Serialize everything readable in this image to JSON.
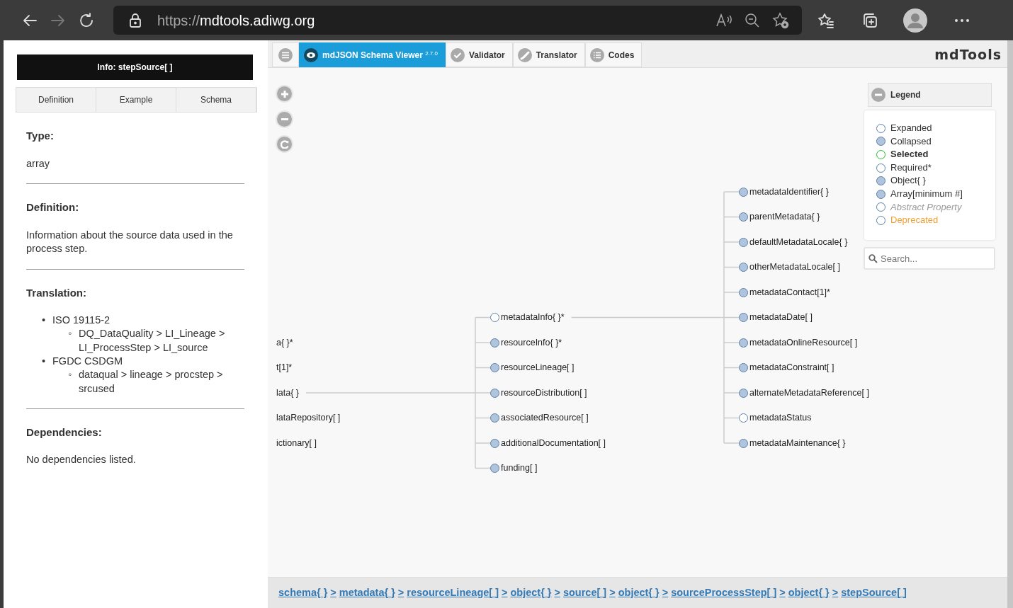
{
  "browser": {
    "url_scheme": "https://",
    "url_host": "mdtools.adiwg.org"
  },
  "info_panel": {
    "title": "Info: stepSource[ ]",
    "tabs": [
      {
        "label": "Definition",
        "selected": false
      },
      {
        "label": "Example",
        "selected": false
      },
      {
        "label": "Schema",
        "selected": false
      }
    ],
    "sections": [
      {
        "kind": "text",
        "heading": "Type:",
        "text": "array"
      },
      {
        "kind": "text",
        "heading": "Definition:",
        "text": "Information about the source data used in the process step."
      },
      {
        "kind": "list",
        "heading": "Translation:",
        "items": [
          {
            "marker": "•",
            "label": "ISO 19115-2",
            "children": [
              {
                "marker": "◦",
                "label": "DQ_DataQuality > LI_Lineage > LI_ProcessStep > LI_source"
              }
            ]
          },
          {
            "marker": "•",
            "label": "FGDC CSDGM",
            "children": [
              {
                "marker": "◦",
                "label": "dataqual > lineage > procstep > srcused"
              }
            ]
          }
        ]
      },
      {
        "kind": "text",
        "heading": "Dependencies:",
        "text": "No dependencies listed."
      }
    ]
  },
  "toolbar": {
    "tabs": [
      {
        "label": "mdJSON Schema Viewer $^{2.7.0}$",
        "kind": "viewer",
        "selected": true
      },
      {
        "label": "Validator",
        "kind": "validator",
        "selected": false
      },
      {
        "label": "Translator",
        "kind": "translator",
        "selected": false
      },
      {
        "label": "Codes",
        "kind": "codes",
        "selected": false
      }
    ],
    "logo": "mdTools"
  },
  "legend": {
    "title": "Legend",
    "expanded": true,
    "items": [
      {
        "kind": "expanded",
        "label": "Expanded"
      },
      {
        "kind": "collapsed",
        "label": "Collapsed"
      },
      {
        "kind": "selected",
        "label": "Selected"
      },
      {
        "kind": "required",
        "label": "Required*"
      },
      {
        "kind": "object",
        "label": "Object{ }"
      },
      {
        "kind": "array",
        "label": "Array[minimum #]"
      },
      {
        "kind": "abstract",
        "label": "Abstract Property"
      },
      {
        "kind": "deprecated",
        "label": "Deprecated"
      }
    ]
  },
  "search": {
    "placeholder": "Search..."
  },
  "tree": [
    {
      "label": "a{ }*"
    },
    {
      "label": "t[1]*"
    },
    {
      "label": "lata{ }",
      "children": [
        {
          "label": "metadataInfo{ }*",
          "collapsed": false,
          "children": [
            {
              "label": "metadataIdentifier{ }",
              "collapsed": true
            },
            {
              "label": "parentMetadata{ }",
              "collapsed": true
            },
            {
              "label": "defaultMetadataLocale{ }",
              "collapsed": true
            },
            {
              "label": "otherMetadataLocale[ ]",
              "collapsed": true
            },
            {
              "label": "metadataContact[1]*",
              "collapsed": true
            },
            {
              "label": "metadataDate[ ]",
              "collapsed": true
            },
            {
              "label": "metadataOnlineResource[ ]",
              "collapsed": true
            },
            {
              "label": "metadataConstraint[ ]",
              "collapsed": true
            },
            {
              "label": "alternateMetadataReference[ ]",
              "collapsed": true
            },
            {
              "label": "metadataStatus",
              "collapsed": false
            },
            {
              "label": "metadataMaintenance{ }",
              "collapsed": true
            }
          ]
        },
        {
          "label": "resourceInfo{ }*",
          "collapsed": true
        },
        {
          "label": "resourceLineage[ ]",
          "collapsed": true
        },
        {
          "label": "resourceDistribution[ ]",
          "collapsed": true
        },
        {
          "label": "associatedResource[ ]",
          "collapsed": true
        },
        {
          "label": "additionalDocumentation[ ]",
          "collapsed": true
        },
        {
          "label": "funding[ ]",
          "collapsed": true
        }
      ]
    },
    {
      "label": "lataRepository[ ]"
    },
    {
      "label": "ictionary[ ]"
    }
  ],
  "breadcrumb": [
    {
      "text": "schema{ }",
      "separator": ">"
    },
    {
      "text": "metadata{ }",
      "separator": ">"
    },
    {
      "text": "resourceLineage[ ]",
      "separator": ">"
    },
    {
      "text": "object{ }",
      "separator": ">"
    },
    {
      "text": "source[ ]",
      "separator": ">"
    },
    {
      "text": "object{ }",
      "separator": ">"
    },
    {
      "text": "sourceProcessStep[ ]",
      "separator": ">"
    },
    {
      "text": "object{ }",
      "separator": ">"
    },
    {
      "text": "stepSource[ ]"
    }
  ]
}
